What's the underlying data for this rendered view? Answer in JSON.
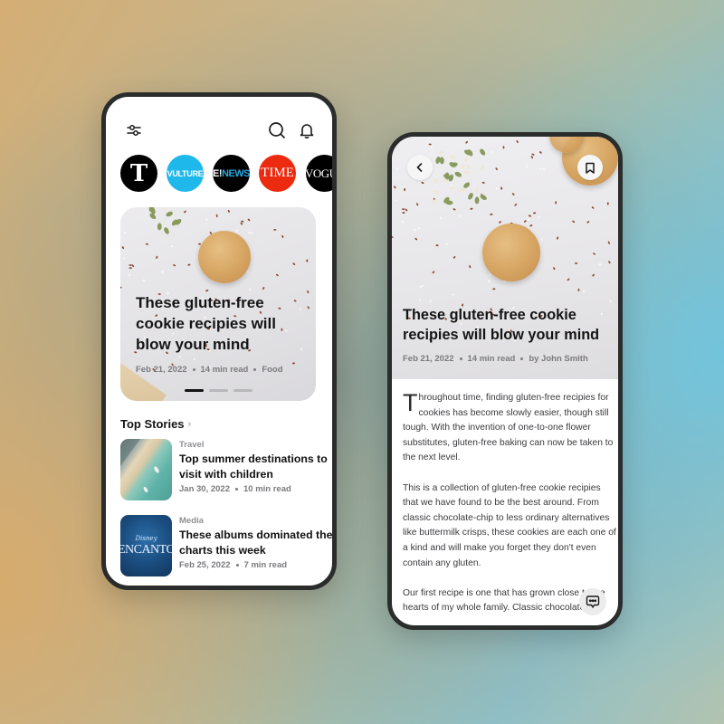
{
  "home": {
    "icons": {
      "filter": "sliders-icon",
      "search": "search-icon",
      "notifications": "bell-icon"
    },
    "sources": [
      {
        "name": "The New York Times",
        "label": "T",
        "color": "#000000"
      },
      {
        "name": "Vulture",
        "label": "VULTURE",
        "color": "#1fb8ea"
      },
      {
        "name": "E! News",
        "label_prefix": "E!",
        "label_suffix": "NEWS",
        "color": "#000000"
      },
      {
        "name": "Time",
        "label": "TIME",
        "color": "#ec2a0f"
      },
      {
        "name": "Vogue",
        "label": "VOGUE",
        "color": "#000000"
      }
    ],
    "featured": {
      "title": "These gluten-free cookie recipies will blow your mind",
      "date": "Feb 21, 2022",
      "read_time": "14 min read",
      "category": "Food",
      "pager": {
        "pages": 3,
        "active": 1
      }
    },
    "top_stories": {
      "heading": "Top Stories",
      "chevron": "›",
      "items": [
        {
          "category": "Travel",
          "title": "Top summer destinations to visit with children",
          "date": "Jan 30, 2022",
          "read_time": "10 min read",
          "thumb": "beach-aerial"
        },
        {
          "category": "Media",
          "title": "These albums dominated the charts this week",
          "date": "Feb 25, 2022",
          "read_time": "7 min read",
          "thumb": "encanto-album",
          "thumb_text": {
            "brand": "Disney",
            "title": "ENCANTO"
          }
        }
      ]
    }
  },
  "article": {
    "icons": {
      "back": "chevron-left-icon",
      "bookmark": "bookmark-icon",
      "comments": "chat-bubble-icon"
    },
    "title": "These gluten-free cookie recipies will blow your mind",
    "date": "Feb 21, 2022",
    "read_time": "14 min read",
    "author": "by John Smith",
    "body": {
      "dropcap": "T",
      "p1_rest": "hroughout time, finding gluten-free recipies for cookies has become slowly easier, though still tough. With the invention of one-to-one flower substitutes, gluten-free baking can now be taken to the next level.",
      "p2": "This is a collection of gluten-free cookie recipies that we have found to be the best around. From classic chocolate-chip to less ordinary alternatives like buttermilk crisps, these cookies are each one of a kind and will make you forget they don't even contain any gluten.",
      "p3": "Our first recipe is one that has grown close to the hearts of my whole family. Classic chocolate is"
    }
  }
}
